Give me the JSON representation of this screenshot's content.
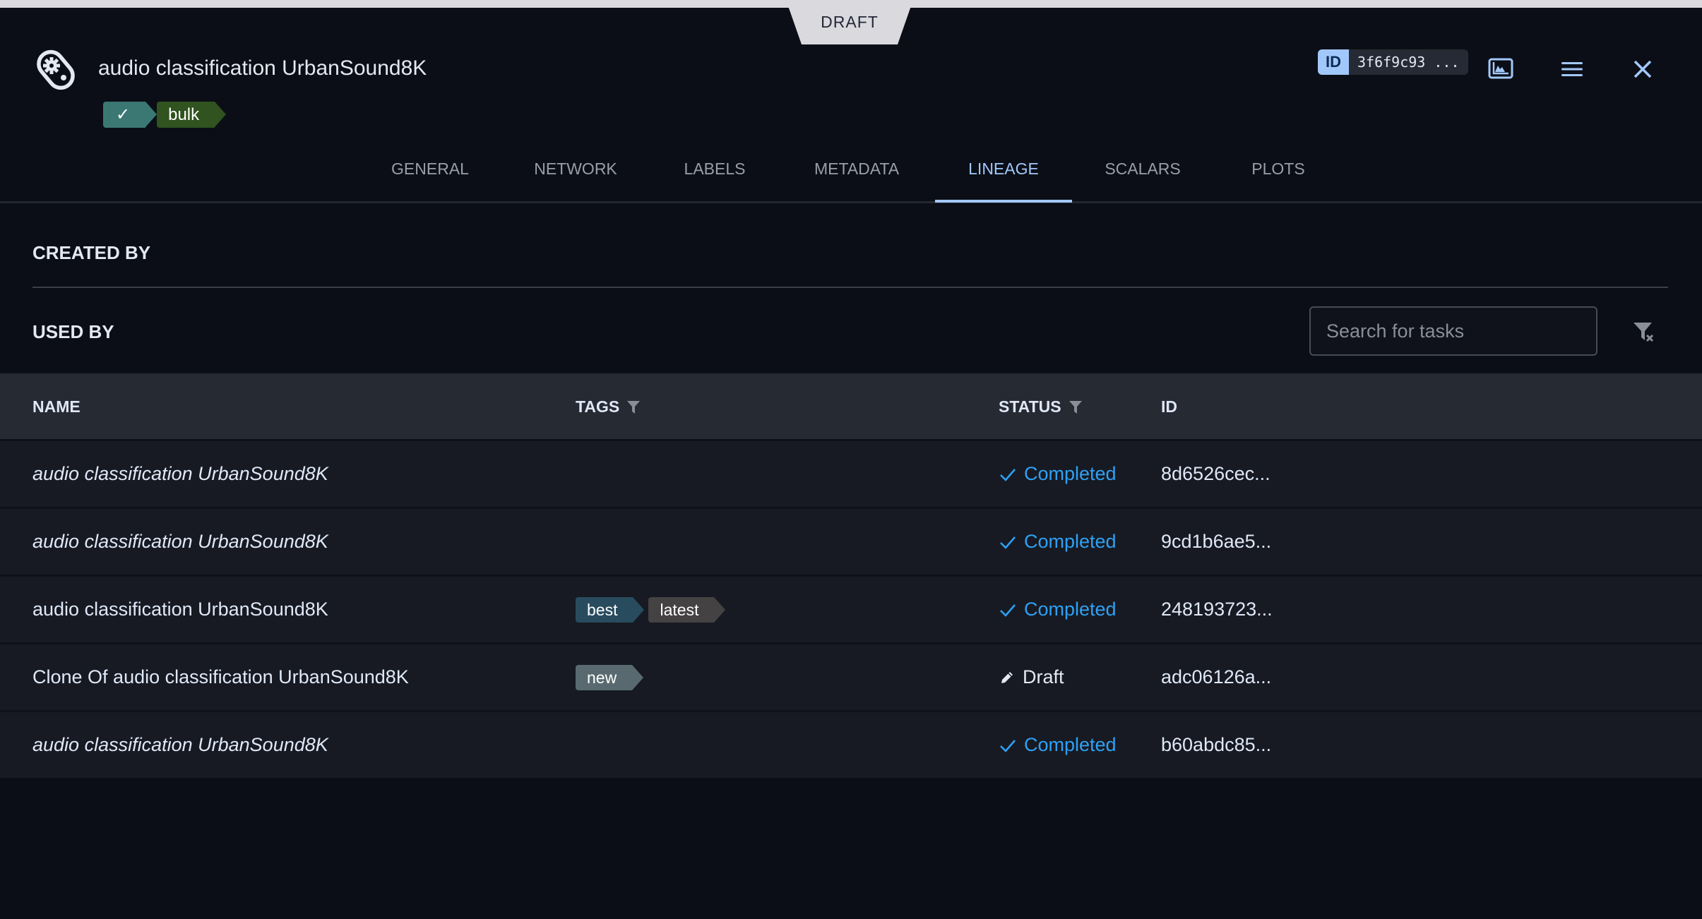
{
  "banner": {
    "label": "DRAFT"
  },
  "header": {
    "title": "audio classification UrbanSound8K",
    "tags": [
      {
        "label": "✓",
        "color": "#3b7874"
      },
      {
        "label": "bulk",
        "color": "#30531f"
      }
    ],
    "id_label": "ID",
    "id_value": "3f6f9c93 ...",
    "icons": [
      "chart-icon",
      "menu-icon",
      "close-icon"
    ]
  },
  "tabs": [
    {
      "label": "GENERAL",
      "active": false
    },
    {
      "label": "NETWORK",
      "active": false
    },
    {
      "label": "LABELS",
      "active": false
    },
    {
      "label": "METADATA",
      "active": false
    },
    {
      "label": "LINEAGE",
      "active": true
    },
    {
      "label": "SCALARS",
      "active": false
    },
    {
      "label": "PLOTS",
      "active": false
    }
  ],
  "sections": {
    "created_by": "CREATED BY",
    "used_by": "USED BY"
  },
  "search": {
    "placeholder": "Search for tasks",
    "value": ""
  },
  "table": {
    "columns": [
      "NAME",
      "TAGS",
      "STATUS",
      "ID"
    ],
    "rows": [
      {
        "name": "audio classification UrbanSound8K",
        "italic": true,
        "tags": [],
        "status": "Completed",
        "id": "8d6526cec..."
      },
      {
        "name": "audio classification UrbanSound8K",
        "italic": true,
        "tags": [],
        "status": "Completed",
        "id": "9cd1b6ae5..."
      },
      {
        "name": "audio classification UrbanSound8K",
        "italic": false,
        "tags": [
          {
            "label": "best",
            "color": "#284c5e"
          },
          {
            "label": "latest",
            "color": "#444242"
          }
        ],
        "status": "Completed",
        "id": "248193723..."
      },
      {
        "name": "Clone Of audio classification UrbanSound8K",
        "italic": false,
        "tags": [
          {
            "label": "new",
            "color": "#586a6f"
          }
        ],
        "status": "Draft",
        "id": "adc06126a..."
      },
      {
        "name": "audio classification UrbanSound8K",
        "italic": true,
        "tags": [],
        "status": "Completed",
        "id": "b60abdc85..."
      }
    ]
  },
  "colors": {
    "accent": "#a2c8fb",
    "completed": "#2ea1f5",
    "background": "#0b0e16",
    "row": "#171a22",
    "header_row": "#262a33"
  }
}
